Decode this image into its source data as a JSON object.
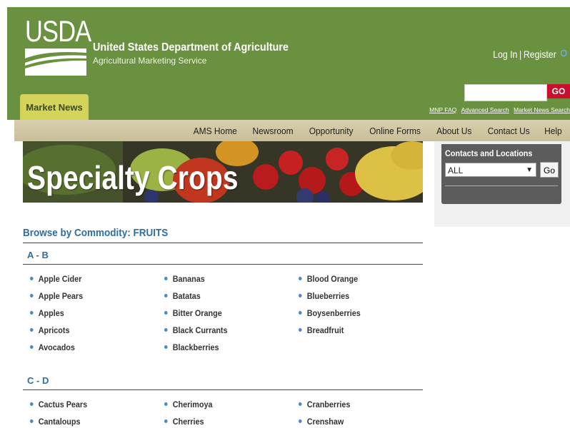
{
  "header": {
    "logo_text": "USDA",
    "department": "United States Department of Agriculture",
    "service": "Agricultural Marketing Service",
    "login": "Log In",
    "separator": "|",
    "register": "Register",
    "search_value": "",
    "go_label": "GO",
    "sublinks": [
      "MNP FAQ",
      "Advanced Search",
      "Market News Search"
    ],
    "tab_label": "Market News"
  },
  "nav": {
    "items": [
      "AMS Home",
      "Newsroom",
      "Opportunity",
      "Online Forms",
      "About Us",
      "Contact Us",
      "Help"
    ]
  },
  "banner": {
    "title": "Specialty Crops"
  },
  "section": {
    "title": "Browse by Commodity: FRUITS",
    "groups": [
      {
        "heading": "A - B",
        "columns": [
          [
            "Apple Cider",
            "Apple Pears",
            "Apples",
            "Apricots",
            "Avocados"
          ],
          [
            "Bananas",
            "Batatas",
            "Bitter Orange",
            "Black Currants",
            "Blackberries"
          ],
          [
            "Blood Orange",
            "Blueberries",
            "Boysenberries",
            "Breadfruit"
          ]
        ]
      },
      {
        "heading": "C - D",
        "columns": [
          [
            "Cactus Pears",
            "Cantaloups"
          ],
          [
            "Cherimoya",
            "Cherries"
          ],
          [
            "Cranberries",
            "Crenshaw"
          ]
        ]
      }
    ]
  },
  "sidebar": {
    "contacts_title": "Contacts and Locations",
    "select_value": "ALL",
    "go_label": "Go"
  },
  "colors": {
    "header_green": "#6a9140",
    "tab_yellow": "#d4d35a",
    "nav_tan": "#d0c6a2",
    "link_blue": "#2d6ea3",
    "go_red": "#c8102e",
    "bullet_blue": "#4a86c5"
  }
}
